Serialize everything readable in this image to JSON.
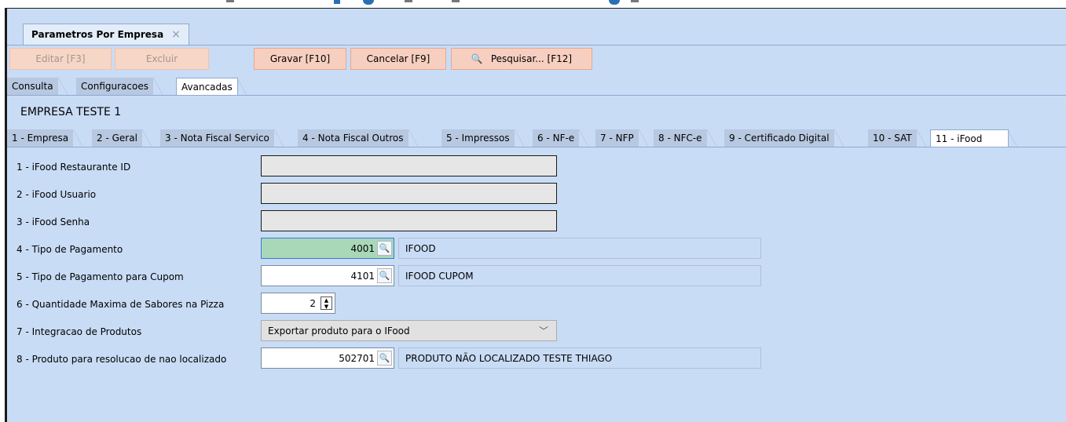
{
  "document_tab": {
    "title": "Parametros Por Empresa",
    "close_icon": "×"
  },
  "toolbar": {
    "edit_label": "Editar [F3]",
    "delete_label": "Excluir",
    "save_label": "Gravar [F10]",
    "cancel_label": "Cancelar [F9]",
    "search_label": "Pesquisar... [F12]"
  },
  "view_tabs": [
    "Consulta",
    "Configuracoes",
    "Avancadas"
  ],
  "company_name": "EMPRESA TESTE 1",
  "section_tabs": [
    "1 - Empresa",
    "2 - Geral",
    "3 - Nota Fiscal Servico",
    "4 - Nota Fiscal Outros",
    "5 - Impressos",
    "6 - NF-e",
    "7 - NFP",
    "8 - NFC-e",
    "9 - Certificado Digital",
    "10 - SAT",
    "11 - iFood"
  ],
  "form": {
    "restaurant_id_label": "1 - iFood Restaurante ID",
    "restaurant_id_value": "",
    "user_label": "2 - iFood Usuario",
    "user_value": "",
    "password_label": "3 - iFood Senha",
    "password_value": "",
    "payment_type_label": "4 - Tipo de Pagamento",
    "payment_type_code": "4001",
    "payment_type_desc": "IFOOD",
    "coupon_payment_label": "5 - Tipo de Pagamento para Cupom",
    "coupon_payment_code": "4101",
    "coupon_payment_desc": "IFOOD CUPOM",
    "max_flavors_label": "6 - Quantidade Maxima de Sabores na Pizza",
    "max_flavors_value": "2",
    "product_integration_label": "7 - Integracao de Produtos",
    "product_integration_value": "Exportar produto para o IFood",
    "not_found_product_label": "8 - Produto para resolucao de nao localizado",
    "not_found_product_code": "502701",
    "not_found_product_desc": "PRODUTO NÃO LOCALIZADO TESTE THIAGO"
  },
  "colors": {
    "background": "#c9dcf5",
    "button": "#f7cfc0",
    "focus": "#a8d8b8"
  }
}
